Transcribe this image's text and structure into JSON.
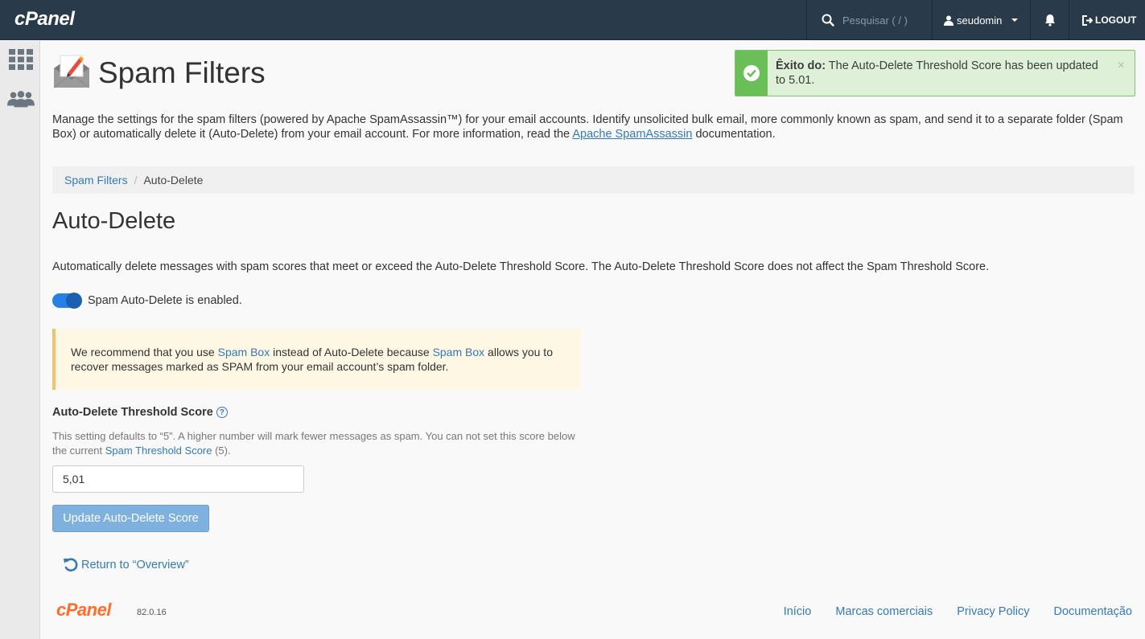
{
  "topbar": {
    "brand": "cPanel",
    "search_placeholder": "Pesquisar ( / )",
    "username": "seudomin",
    "logout_label": "LOGOUT"
  },
  "page": {
    "title": "Spam Filters",
    "intro_text": "Manage the settings for the spam filters (powered by Apache SpamAssassin™) for your email accounts. Identify unsolicited bulk email, more commonly known as spam, and send it to a separate folder (Spam Box) or automatically delete it (Auto-Delete) from your email account. For more information, read the ",
    "intro_link": "Apache SpamAssassin",
    "intro_suffix": " documentation."
  },
  "breadcrumb": {
    "parent": "Spam Filters",
    "current": "Auto-Delete"
  },
  "section": {
    "title": "Auto-Delete",
    "description": "Automatically delete messages with spam scores that meet or exceed the Auto-Delete Threshold Score. The Auto-Delete Threshold Score does not affect the Spam Threshold Score.",
    "toggle_label": "Spam Auto-Delete is enabled.",
    "toggle_on": true
  },
  "warning": {
    "part1": "We recommend that you use ",
    "link1": "Spam Box",
    "part2": " instead of Auto-Delete because ",
    "link2": "Spam Box",
    "part3": " allows you to recover messages marked as SPAM from your email account’s spam folder."
  },
  "form": {
    "label": "Auto-Delete Threshold Score",
    "help_part1": "This setting defaults to “5”. A higher number will mark fewer messages as spam. You can not set this score below the current ",
    "help_link": "Spam Threshold Score",
    "help_part2": " (5).",
    "input_value": "5,01",
    "button_label": "Update Auto-Delete Score"
  },
  "return_link": "Return to “Overview”",
  "footer": {
    "brand": "cPanel",
    "version": "82.0.16",
    "links": [
      "Início",
      "Marcas comerciais",
      "Privacy Policy",
      "Documentação"
    ]
  },
  "alert": {
    "prefix": "Êxito do:",
    "message": " The Auto-Delete Threshold Score has been updated to 5.01.",
    "close": "×"
  },
  "colors": {
    "topbar": "#293a4a",
    "link": "#337ab7",
    "success": "#6bbf59",
    "brand_orange": "#ff6c2c"
  }
}
